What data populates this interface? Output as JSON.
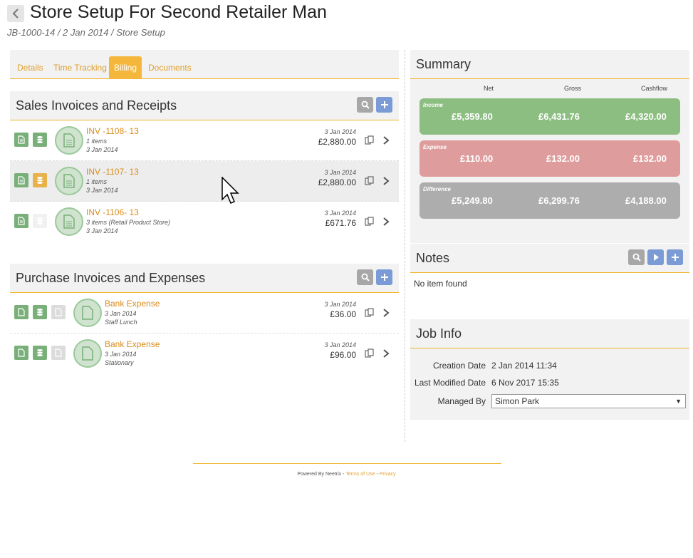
{
  "header": {
    "title": "Store Setup For Second Retailer Man",
    "breadcrumb": "JB-1000-14 / 2 Jan 2014 / Store Setup"
  },
  "tabs": [
    {
      "label": "Details",
      "active": false
    },
    {
      "label": "Time Tracking",
      "active": false
    },
    {
      "label": "Billing",
      "active": true
    },
    {
      "label": "Documents",
      "active": false
    }
  ],
  "sales": {
    "title": "Sales Invoices and Receipts",
    "items": [
      {
        "title": "INV -1108- 13",
        "line1": "1 items",
        "line2": "3 Jan 2014",
        "date": "3 Jan 2014",
        "amount": "£2,880.00"
      },
      {
        "title": "INV -1107- 13",
        "line1": "1 items",
        "line2": "3 Jan 2014",
        "date": "3 Jan 2014",
        "amount": "£2,880.00"
      },
      {
        "title": "INV -1106- 13",
        "line1": "3 items (Retail Product Store)",
        "line2": "3 Jan 2014",
        "date": "3 Jan 2014",
        "amount": "£671.76"
      }
    ]
  },
  "purchases": {
    "title": "Purchase Invoices and Expenses",
    "items": [
      {
        "title": "Bank Expense",
        "line1": "3 Jan 2014",
        "line2": "Staff Lunch",
        "date": "3 Jan 2014",
        "amount": "£36.00"
      },
      {
        "title": "Bank Expense",
        "line1": "3 Jan 2014",
        "line2": "Stationary",
        "date": "3 Jan 2014",
        "amount": "£96.00"
      }
    ]
  },
  "summary": {
    "title": "Summary",
    "columns": [
      "Net",
      "Gross",
      "Cashflow"
    ],
    "income": {
      "label": "Income",
      "net": "£5,359.80",
      "gross": "£6,431.76",
      "cashflow": "£4,320.00",
      "color": "#8cbd81"
    },
    "expense": {
      "label": "Expense",
      "net": "£110.00",
      "gross": "£132.00",
      "cashflow": "£132.00",
      "color": "#df9c9c"
    },
    "difference": {
      "label": "Difference",
      "net": "£5,249.80",
      "gross": "£6,299.76",
      "cashflow": "£4,188.00",
      "color": "#adadad"
    }
  },
  "notes": {
    "title": "Notes",
    "empty_text": "No item found"
  },
  "job_info": {
    "title": "Job Info",
    "creation_label": "Creation Date",
    "creation_value": "2 Jan 2014 11:34",
    "modified_label": "Last Modified Date",
    "modified_value": "6 Nov 2017 15:35",
    "managed_label": "Managed By",
    "managed_value": "Simon Park"
  },
  "footer": {
    "powered": "Powered By Neetrix - ",
    "terms": "Terms of Use",
    "sep": " - ",
    "privacy": "Privacy"
  },
  "colors": {
    "accent": "#f0b429",
    "link": "#d98c1a",
    "blue_button": "#7a9bd6",
    "grey_button": "#a7a7a7"
  }
}
